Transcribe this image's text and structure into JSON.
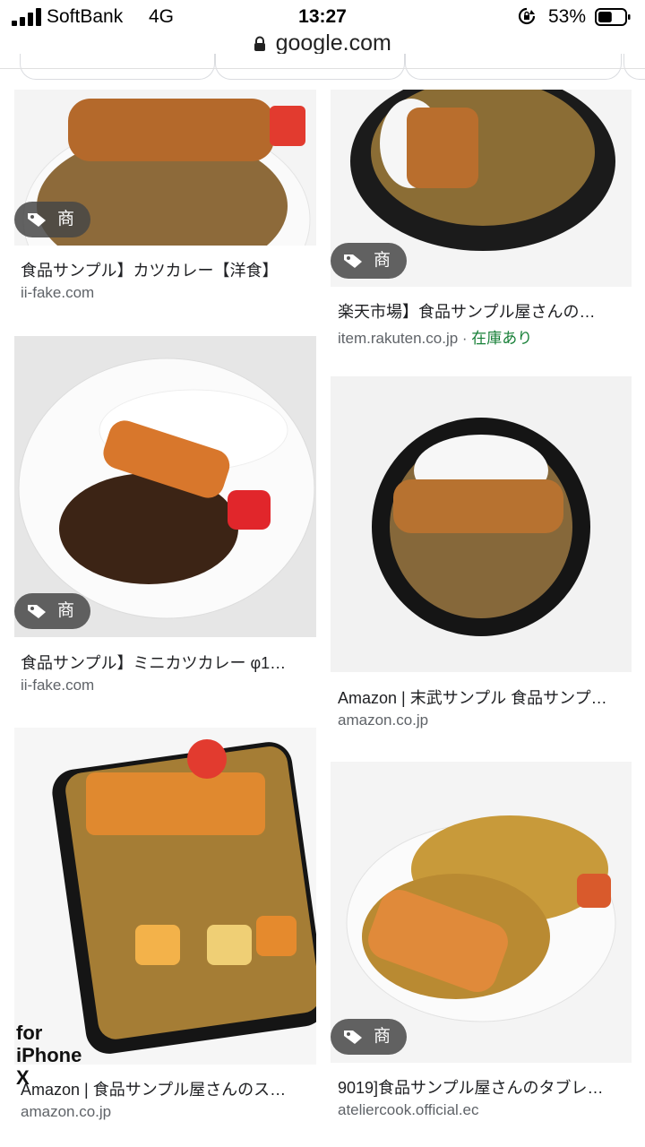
{
  "status_bar": {
    "carrier": "SoftBank",
    "network": "4G",
    "time": "13:27",
    "battery_percent": "53%",
    "battery_level": 0.53
  },
  "browser": {
    "url": "google.com"
  },
  "results": [
    {
      "title": "食品サンプル】カツカレー【洋食】",
      "source": "ii-fake.com",
      "badge": "商品"
    },
    {
      "title": "楽天市場】食品サンプル屋さんの…",
      "source": "item.rakuten.co.jp",
      "source_sep": " · ",
      "availability": "在庫あり",
      "badge": "商品"
    },
    {
      "title": "食品サンプル】ミニカツカレー φ1…",
      "source": "ii-fake.com",
      "badge": "商品"
    },
    {
      "title": "Amazon | 末武サンプル 食品サンプ…",
      "source": "amazon.co.jp"
    },
    {
      "title": "Amazon | 食品サンプル屋さんのス…",
      "source": "amazon.co.jp",
      "overlay_text": [
        "for",
        "iPhone X"
      ]
    },
    {
      "title": "9019]食品サンプル屋さんのタブレ…",
      "source": "ateliercook.official.ec",
      "badge": "商品"
    }
  ]
}
